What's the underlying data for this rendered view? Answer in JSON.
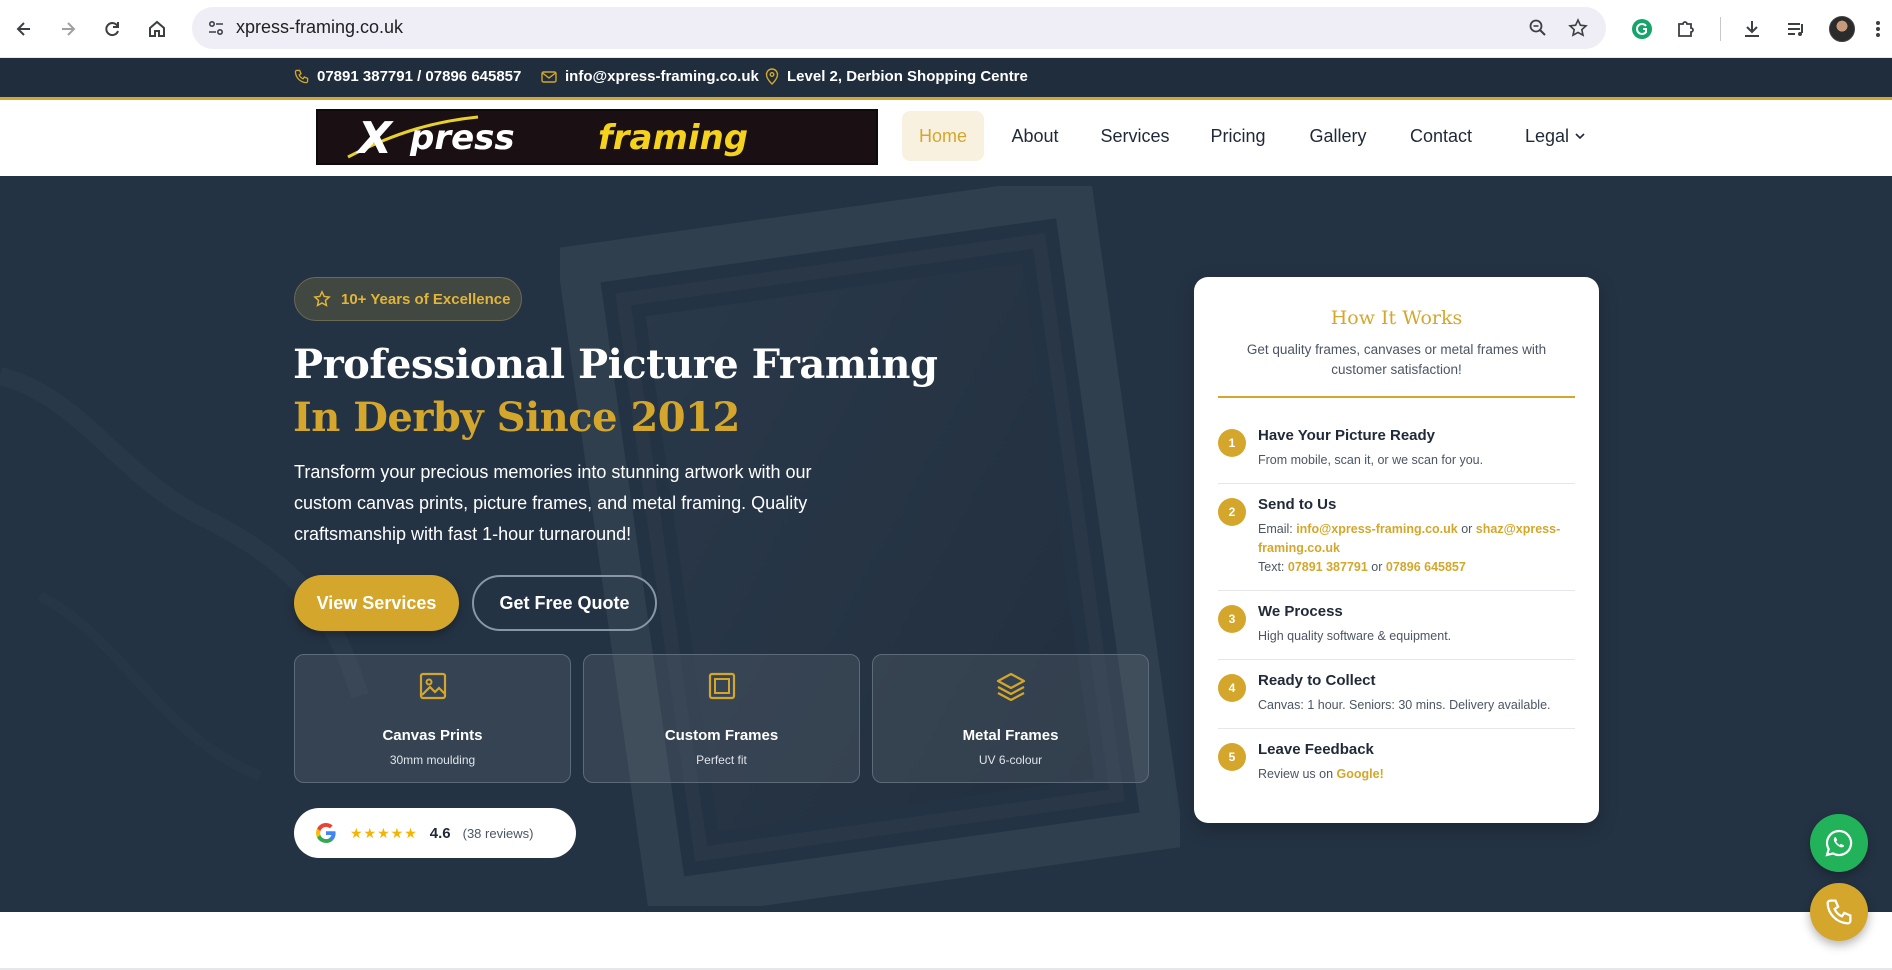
{
  "browser": {
    "url": "xpress-framing.co.uk",
    "icons": [
      "back-icon",
      "forward-icon",
      "reload-icon",
      "home-icon",
      "site-info-icon",
      "zoom-icon",
      "bookmark-star-icon",
      "grammarly-icon",
      "extensions-icon",
      "download-icon",
      "media-icon",
      "profile-avatar",
      "more-icon"
    ]
  },
  "topbar": {
    "phone": "07891 387791  /  07896 645857",
    "email": "info@xpress-framing.co.uk",
    "address": "Level 2, Derbion Shopping Centre"
  },
  "header": {
    "logo_text_x": "X",
    "logo_text_press": "press",
    "logo_text_framing": "framing",
    "nav": {
      "home": "Home",
      "about": "About",
      "services": "Services",
      "pricing": "Pricing",
      "gallery": "Gallery",
      "contact": "Contact",
      "legal": "Legal"
    }
  },
  "hero": {
    "badge": "10+ Years of Excellence",
    "title_line1": "Professional Picture Framing",
    "title_line2": "In Derby Since 2012",
    "description": "Transform your precious memories into stunning artwork with our custom canvas prints, picture frames, and metal framing. Quality craftsmanship with fast 1-hour turnaround!",
    "btn_primary": "View Services",
    "btn_secondary": "Get Free Quote",
    "cards": [
      {
        "title": "Canvas Prints",
        "subtitle": "30mm moulding",
        "icon": "image-icon"
      },
      {
        "title": "Custom Frames",
        "subtitle": "Perfect fit",
        "icon": "frame-icon"
      },
      {
        "title": "Metal Frames",
        "subtitle": "UV 6-colour",
        "icon": "layers-icon"
      }
    ],
    "reviews": {
      "stars": "★★★★★",
      "rating": "4.6",
      "count": "(38 reviews)"
    }
  },
  "how_it_works": {
    "title": "How It Works",
    "subtitle": "Get quality frames, canvases or metal frames with customer satisfaction!",
    "steps": [
      {
        "num": "1",
        "title": "Have Your Picture Ready",
        "desc": "From mobile, scan it, or we scan for you."
      },
      {
        "num": "2",
        "title": "Send to Us",
        "email_label": "Email: ",
        "email1": "info@xpress-framing.co.uk",
        "or": " or ",
        "email2": "shaz@xpress-framing.co.uk",
        "text_label": "Text: ",
        "phone1": "07891 387791",
        "phone2": "07896 645857"
      },
      {
        "num": "3",
        "title": "We Process",
        "desc": "High quality software & equipment."
      },
      {
        "num": "4",
        "title": "Ready to Collect",
        "desc": "Canvas: 1 hour. Seniors: 30 mins. Delivery available."
      },
      {
        "num": "5",
        "title": "Leave Feedback",
        "desc_prefix": "Review us on ",
        "link": "Google",
        "desc_suffix": "!"
      }
    ]
  },
  "colors": {
    "accent": "#d4a72c",
    "navy": "#243344",
    "topbar": "#1f2d3d",
    "whatsapp": "#22b35a"
  }
}
